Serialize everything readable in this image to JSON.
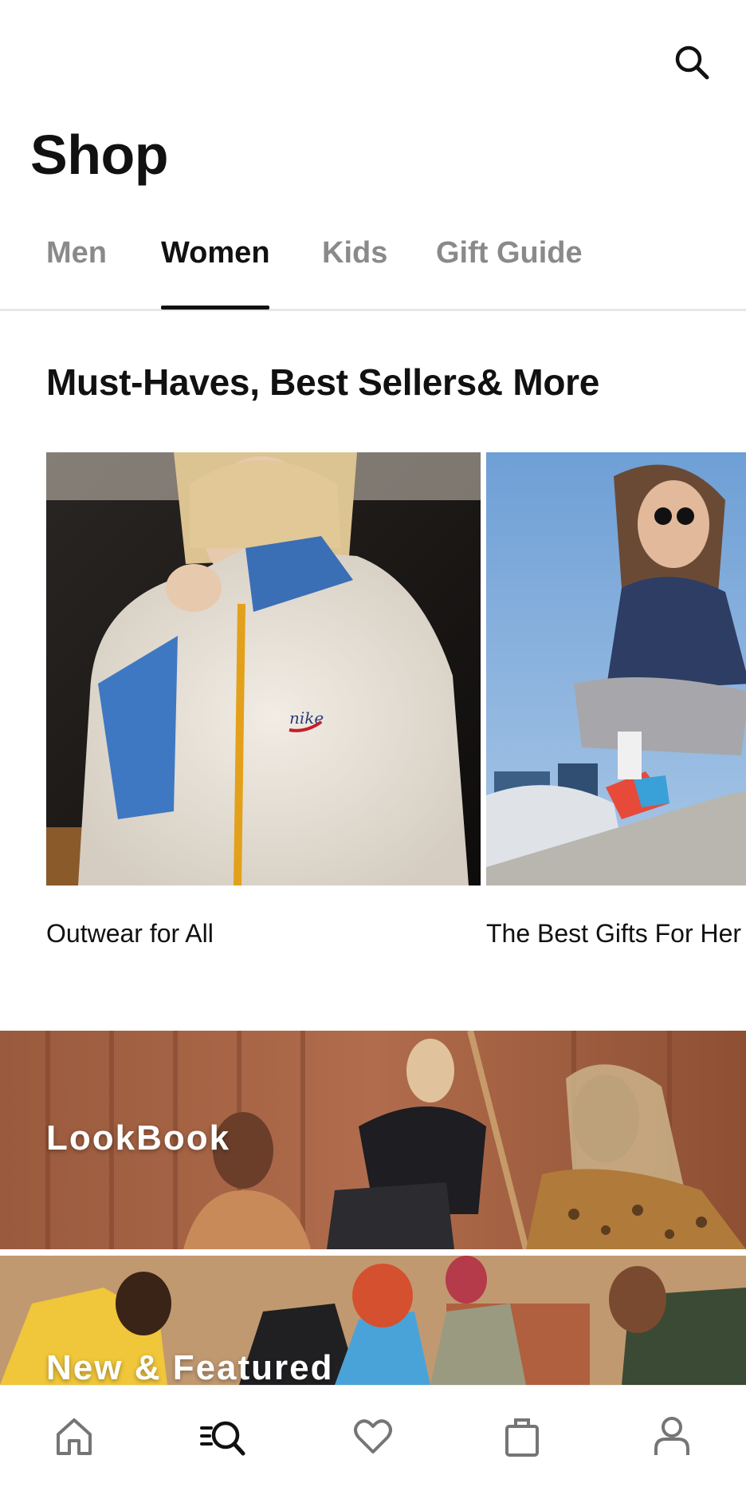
{
  "header": {
    "search_icon": "search-icon"
  },
  "page_title": "Shop",
  "tabs": [
    {
      "label": "Men",
      "active": false
    },
    {
      "label": "Women",
      "active": true
    },
    {
      "label": "Kids",
      "active": false
    },
    {
      "label": "Gift Guide",
      "active": false
    }
  ],
  "section": {
    "title": "Must-Haves, Best Sellers& More",
    "cards": [
      {
        "label": "Outwear for All"
      },
      {
        "label": "The Best Gifts For Her"
      }
    ]
  },
  "banners": [
    {
      "label": "LookBook"
    },
    {
      "label": "New & Featured"
    }
  ],
  "bottom_nav": [
    {
      "icon": "home-icon",
      "active": false
    },
    {
      "icon": "shop-search-icon",
      "active": true
    },
    {
      "icon": "heart-icon",
      "active": false
    },
    {
      "icon": "bag-icon",
      "active": false
    },
    {
      "icon": "profile-icon",
      "active": false
    }
  ],
  "colors": {
    "active": "#111111",
    "inactive": "#8a8a8a",
    "divider": "#e6e6e6",
    "nav_icon": "#757575"
  }
}
